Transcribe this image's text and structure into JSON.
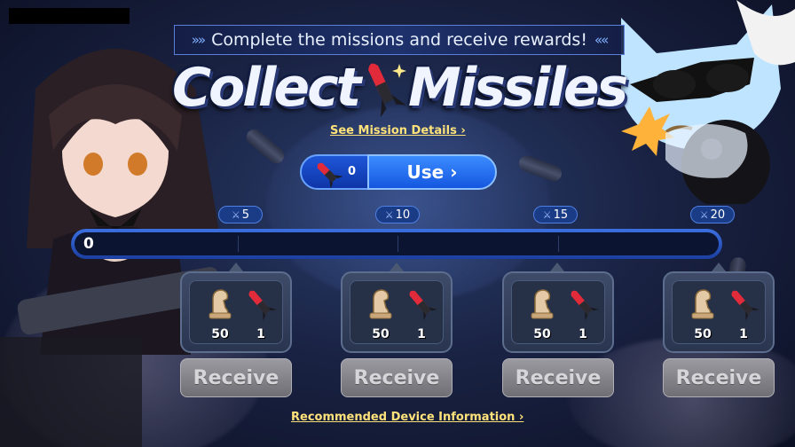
{
  "banner": {
    "mission_text": "Complete the missions and receive rewards!",
    "chevrons_left": "»»",
    "chevrons_right": "««"
  },
  "title": {
    "part1": "Collect",
    "part2": "Missiles"
  },
  "links": {
    "details": "See Mission Details ›",
    "device_info": "Recommended Device Information ›"
  },
  "missile_counter": {
    "count": "0",
    "use_label": "Use ›"
  },
  "progress": {
    "value_label": "0",
    "current": 0,
    "max": 20,
    "milestones": [
      {
        "label": "5",
        "icon": "crossed-swords-icon"
      },
      {
        "label": "10",
        "icon": "crossed-swords-icon"
      },
      {
        "label": "15",
        "icon": "crossed-swords-icon"
      },
      {
        "label": "20",
        "icon": "crossed-swords-icon"
      }
    ]
  },
  "rewards": [
    {
      "coin_qty": "50",
      "missile_qty": "1",
      "button": "Receive"
    },
    {
      "coin_qty": "50",
      "missile_qty": "1",
      "button": "Receive"
    },
    {
      "coin_qty": "50",
      "missile_qty": "1",
      "button": "Receive"
    },
    {
      "coin_qty": "50",
      "missile_qty": "1",
      "button": "Receive"
    }
  ],
  "colors": {
    "link": "#ffe27a",
    "button_blue": "#1557e0",
    "receive_disabled": "#7e7e84"
  }
}
